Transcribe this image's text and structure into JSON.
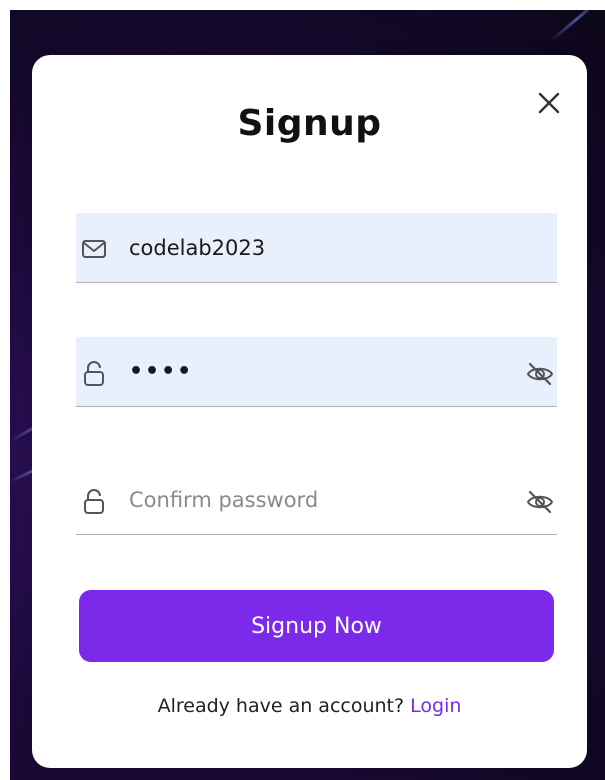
{
  "modal": {
    "title": "Signup",
    "close_icon": "close-icon"
  },
  "form": {
    "email": {
      "value": "codelab2023",
      "icon": "mail-icon"
    },
    "password": {
      "value": "••••",
      "icon": "lock-icon",
      "toggle_icon": "eye-off-icon"
    },
    "confirm_password": {
      "placeholder": "Confirm password",
      "icon": "lock-icon",
      "toggle_icon": "eye-off-icon"
    },
    "submit_label": "Signup Now"
  },
  "footer": {
    "prompt": "Already have an account?",
    "login_label": "Login"
  },
  "colors": {
    "accent": "#7a2ae8",
    "filled_field": "#e8effd",
    "backdrop": "#1d0a3c"
  }
}
